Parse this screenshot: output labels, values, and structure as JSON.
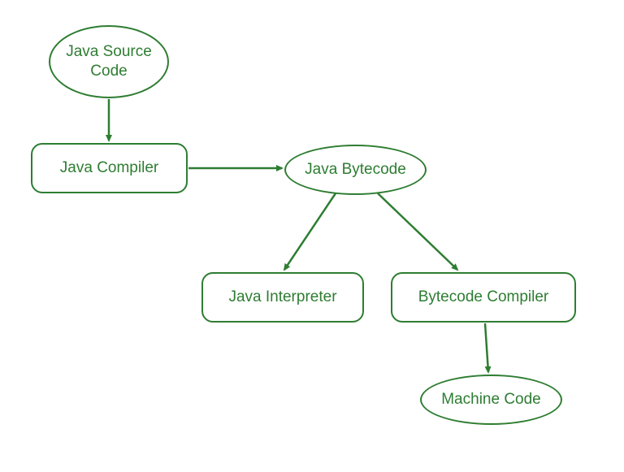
{
  "diagram": {
    "nodes": {
      "source": "Java Source\nCode",
      "compiler": "Java Compiler",
      "bytecode": "Java Bytecode",
      "interpreter": "Java Interpreter",
      "bytecodeCompiler": "Bytecode Compiler",
      "machine": "Machine Code"
    },
    "color": "#2e7d32",
    "edges": [
      [
        "source",
        "compiler"
      ],
      [
        "compiler",
        "bytecode"
      ],
      [
        "bytecode",
        "interpreter"
      ],
      [
        "bytecode",
        "bytecodeCompiler"
      ],
      [
        "bytecodeCompiler",
        "machine"
      ]
    ]
  }
}
